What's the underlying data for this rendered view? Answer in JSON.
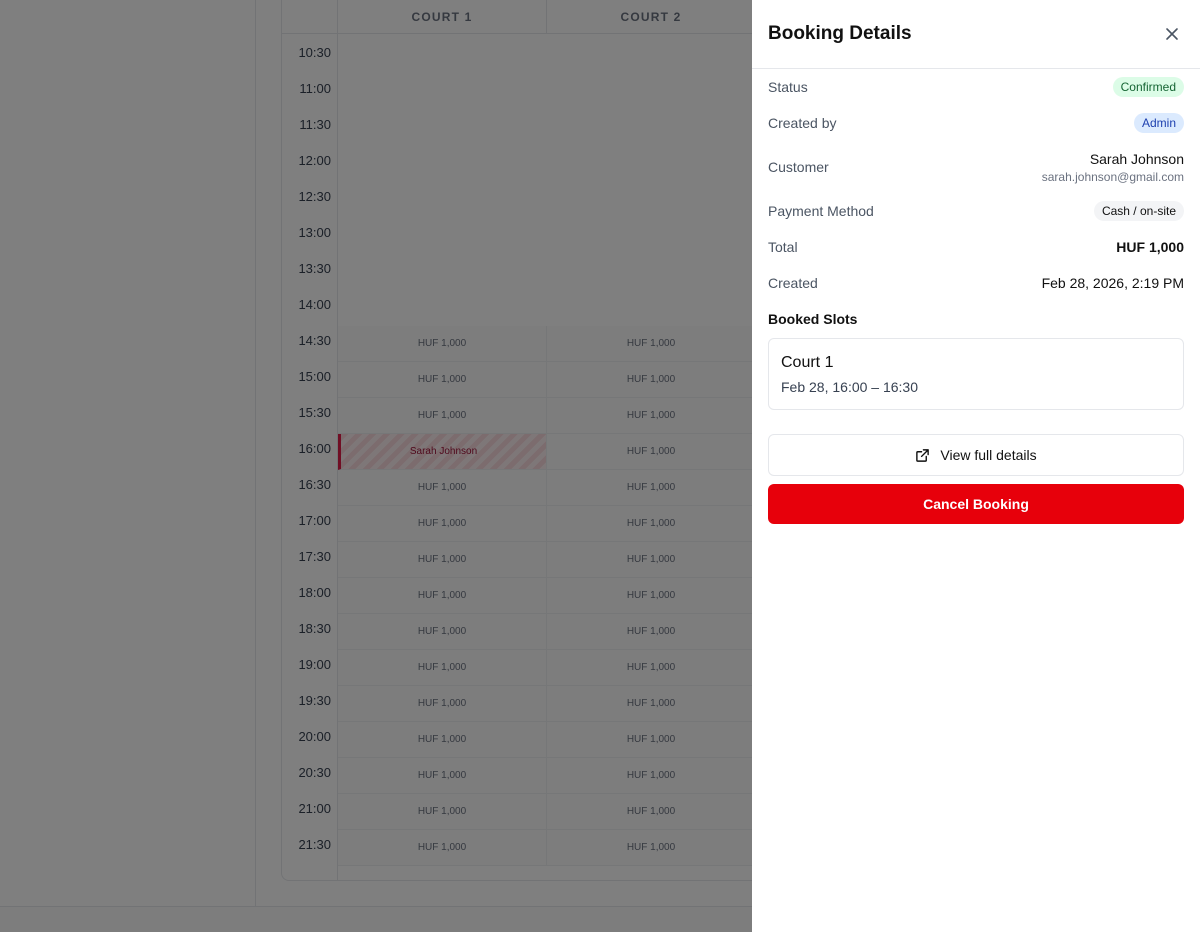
{
  "scheduler": {
    "courts": [
      "COURT 1",
      "COURT 2"
    ],
    "time_labels": [
      "10:30",
      "11:00",
      "11:30",
      "12:00",
      "12:30",
      "13:00",
      "13:30",
      "14:00",
      "14:30",
      "15:00",
      "15:30",
      "16:00",
      "16:30",
      "17:00",
      "17:30",
      "18:00",
      "18:30",
      "19:00",
      "19:30",
      "20:00",
      "20:30",
      "21:00",
      "21:30"
    ],
    "slot_price": "HUF 1,000",
    "booked_name": "Sarah Johnson"
  },
  "drawer": {
    "title": "Booking Details",
    "close_icon": "close-icon",
    "status_label": "Status",
    "status_value": "Confirmed",
    "created_by_label": "Created by",
    "created_by_value": "Admin",
    "customer_label": "Customer",
    "customer_name": "Sarah Johnson",
    "customer_email": "sarah.johnson@gmail.com",
    "payment_label": "Payment Method",
    "payment_value": "Cash / on-site",
    "total_label": "Total",
    "total_value": "HUF 1,000",
    "created_label": "Created",
    "created_value": "Feb 28, 2026, 2:19 PM",
    "slots_heading": "Booked Slots",
    "slot_court": "Court 1",
    "slot_time": "Feb 28, 16:00 – 16:30",
    "view_button": "View full details",
    "cancel_button": "Cancel Booking"
  },
  "colors": {
    "danger": "#e7000b",
    "confirmed_bg": "#dcfce7",
    "admin_bg": "#dbeafe"
  }
}
